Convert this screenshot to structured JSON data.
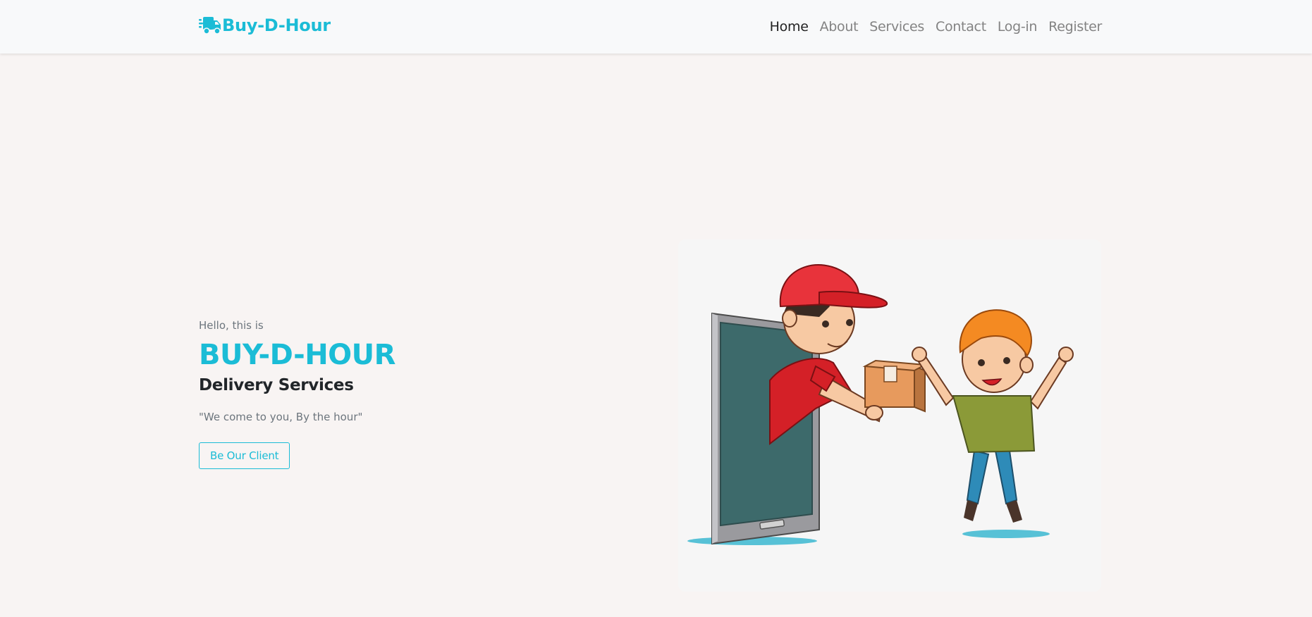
{
  "brand": {
    "name": "Buy-D-Hour",
    "icon": "truck-fast-icon",
    "color": "#1bbcd6"
  },
  "nav": {
    "items": [
      {
        "label": "Home",
        "active": true
      },
      {
        "label": "About"
      },
      {
        "label": "Services"
      },
      {
        "label": "Contact"
      },
      {
        "label": "Log-in"
      },
      {
        "label": "Register"
      }
    ]
  },
  "hero": {
    "greeting": "Hello, this is",
    "title": "BUY-D-HOUR",
    "subtitle": "Delivery Services",
    "tagline": "\"We come to you, By the hour\"",
    "cta_label": "Be Our Client"
  },
  "illustration": {
    "icon": "delivery-illustration"
  }
}
